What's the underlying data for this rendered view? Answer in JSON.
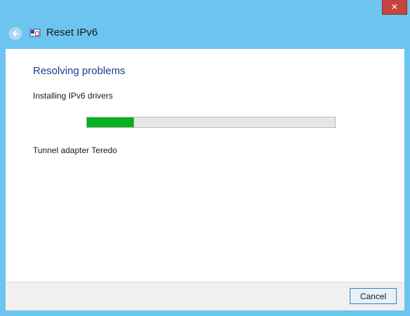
{
  "window": {
    "title": "Reset IPv6",
    "close_label": "✕"
  },
  "icons": {
    "back": "back-arrow-icon",
    "app": "network-troubleshooter-icon",
    "close": "close-icon"
  },
  "main": {
    "heading": "Resolving problems",
    "status": "Installing IPv6 drivers",
    "progress_fraction": 0.19,
    "detail": "Tunnel adapter Teredo"
  },
  "footer": {
    "cancel_label": "Cancel"
  },
  "colors": {
    "frame": "#6cc4f0",
    "heading": "#1f3b8c",
    "progress_fill": "#06b025",
    "close": "#c7443c"
  }
}
